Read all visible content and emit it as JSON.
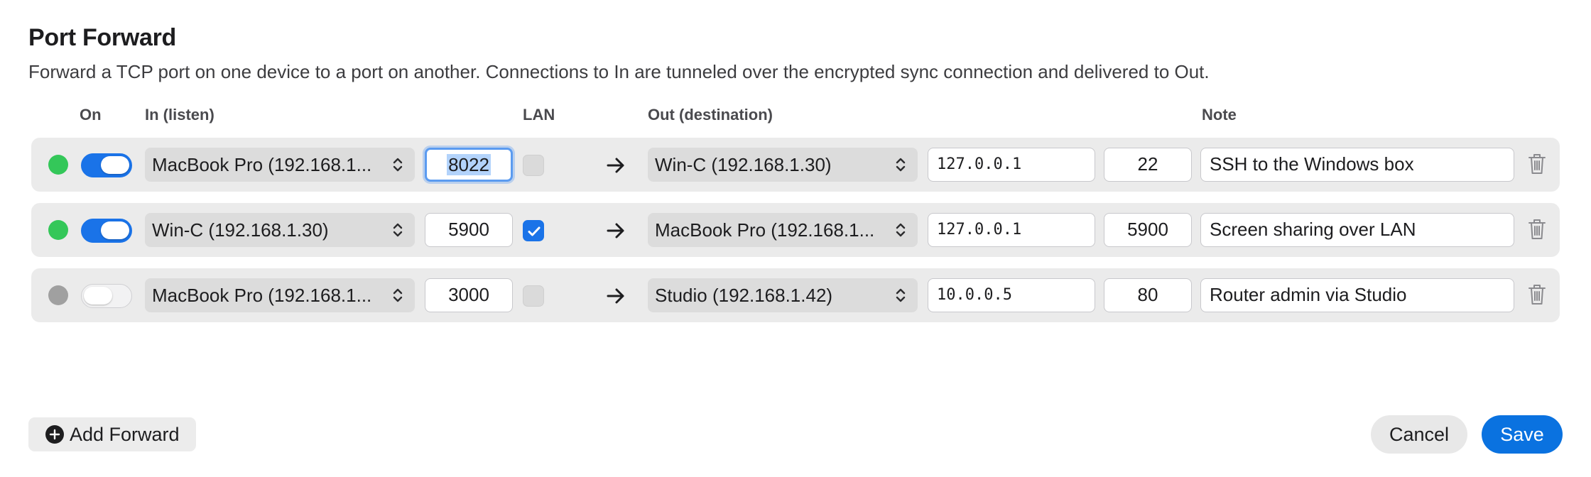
{
  "header": {
    "title": "Port Forward",
    "subtitle": "Forward a TCP port on one device to a port on another. Connections to In are tunneled over the encrypted sync connection and delivered to Out."
  },
  "columns": {
    "on": "On",
    "in": "In (listen)",
    "lan": "LAN",
    "out": "Out (destination)",
    "note": "Note"
  },
  "colors": {
    "status_active": "#34c759",
    "status_inactive": "#a0a0a0",
    "accent": "#1a73e8",
    "save_button": "#0a72e0"
  },
  "rows": [
    {
      "status": "active",
      "enabled": true,
      "in_device": "MacBook Pro (192.168.1...",
      "in_port": "8022",
      "in_port_focused": true,
      "lan": false,
      "out_device": "Win-C (192.168.1.30)",
      "out_host": "127.0.0.1",
      "out_port": "22",
      "note": "SSH to the Windows box"
    },
    {
      "status": "active",
      "enabled": true,
      "in_device": "Win-C (192.168.1.30)",
      "in_port": "5900",
      "in_port_focused": false,
      "lan": true,
      "out_device": "MacBook Pro (192.168.1...",
      "out_host": "127.0.0.1",
      "out_port": "5900",
      "note": "Screen sharing over LAN"
    },
    {
      "status": "inactive",
      "enabled": false,
      "in_device": "MacBook Pro (192.168.1...",
      "in_port": "3000",
      "in_port_focused": false,
      "lan": false,
      "out_device": "Studio (192.168.1.42)",
      "out_host": "10.0.0.5",
      "out_port": "80",
      "note": "Router admin via Studio"
    }
  ],
  "icons": {
    "row_arrow": "arrow-right-icon",
    "row_delete": "trash-icon",
    "select_chevron": "chevron-up-down-icon",
    "add": "plus-circle-icon"
  },
  "footer": {
    "add_label": "Add Forward",
    "cancel_label": "Cancel",
    "save_label": "Save"
  }
}
